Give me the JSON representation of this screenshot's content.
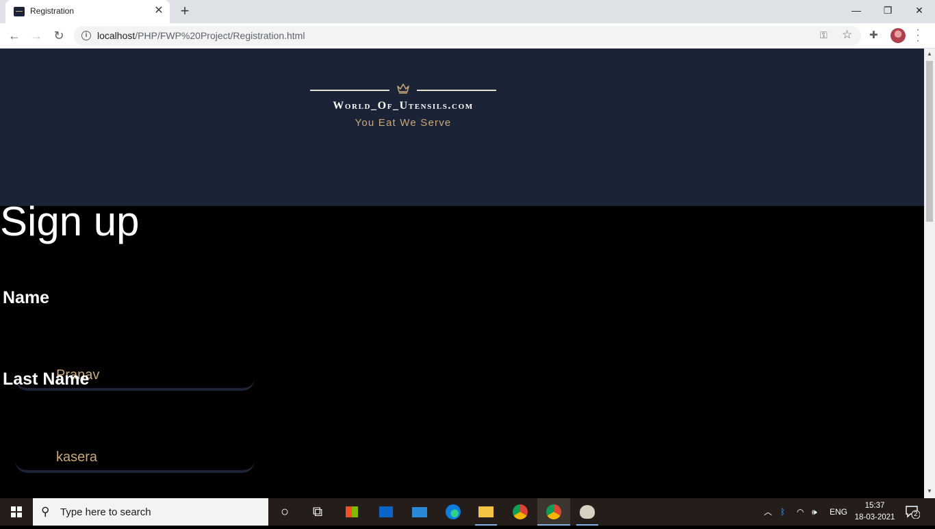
{
  "browser": {
    "tab_title": "Registration",
    "tab_close": "✕",
    "new_tab": "+",
    "url_host": "localhost",
    "url_path": "/PHP/FWP%20Project/Registration.html",
    "window_controls": {
      "minimize": "—",
      "restore": "❐",
      "close": "✕"
    }
  },
  "page": {
    "brand": "World_Of_Utensils.com",
    "tagline": "You Eat We Serve",
    "title": "Sign up",
    "fields": [
      {
        "label": "Name",
        "value": "Pranav"
      },
      {
        "label": "Last Name",
        "value": "kasera"
      }
    ]
  },
  "taskbar": {
    "search_placeholder": "Type here to search",
    "language": "ENG",
    "time": "15:37",
    "date": "18-03-2021",
    "notification_count": "2"
  },
  "colors": {
    "hero_bg": "#1b2336",
    "accent_gold": "#c9a97a",
    "page_bg": "#000000"
  }
}
